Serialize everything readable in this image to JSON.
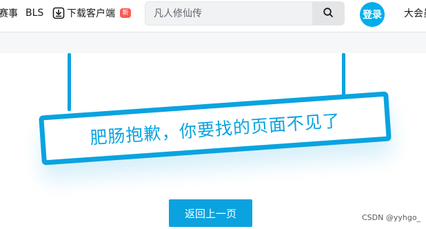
{
  "header": {
    "nav_events": "赛事",
    "nav_bls": "BLS",
    "nav_download": "下载客户端",
    "download_badge": "新",
    "download_icon": "download-icon",
    "search_placeholder": "凡人修仙传",
    "search_icon": "search-icon",
    "login_label": "登录",
    "nav_vip": "大会员"
  },
  "main": {
    "error_message": "肥肠抱歉，你要找的页面不见了",
    "back_button": "返回上一页"
  },
  "watermark": "CSDN @yyhgo_",
  "colors": {
    "accent": "#0aa3e0",
    "login_bg": "#00aeec",
    "badge_bg": "#f85a54"
  }
}
